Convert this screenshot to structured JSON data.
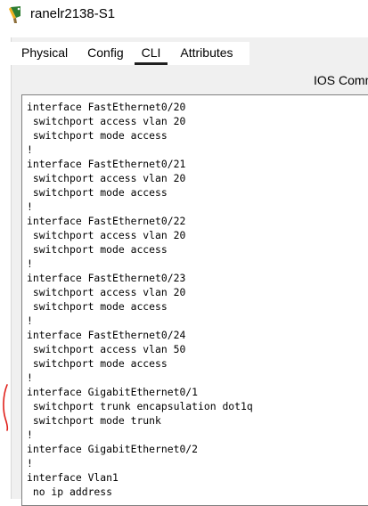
{
  "window": {
    "title": "ranelr2138-S1",
    "icon": "router-device-icon"
  },
  "tabs": [
    {
      "label": "Physical",
      "active": false
    },
    {
      "label": "Config",
      "active": false
    },
    {
      "label": "CLI",
      "active": true
    },
    {
      "label": "Attributes",
      "active": false
    }
  ],
  "panel": {
    "header_label": "IOS Comm"
  },
  "console": {
    "lines": [
      "interface FastEthernet0/20",
      " switchport access vlan 20",
      " switchport mode access",
      "!",
      "interface FastEthernet0/21",
      " switchport access vlan 20",
      " switchport mode access",
      "!",
      "interface FastEthernet0/22",
      " switchport access vlan 20",
      " switchport mode access",
      "!",
      "interface FastEthernet0/23",
      " switchport access vlan 20",
      " switchport mode access",
      "!",
      "interface FastEthernet0/24",
      " switchport access vlan 50",
      " switchport mode access",
      "!",
      "interface GigabitEthernet0/1",
      " switchport trunk encapsulation dot1q",
      " switchport mode trunk",
      "!",
      "interface GigabitEthernet0/2",
      "!",
      "interface Vlan1",
      " no ip address"
    ]
  },
  "colors": {
    "annotation": "#e0201a",
    "active_tab_underline": "#1f1f1f"
  }
}
